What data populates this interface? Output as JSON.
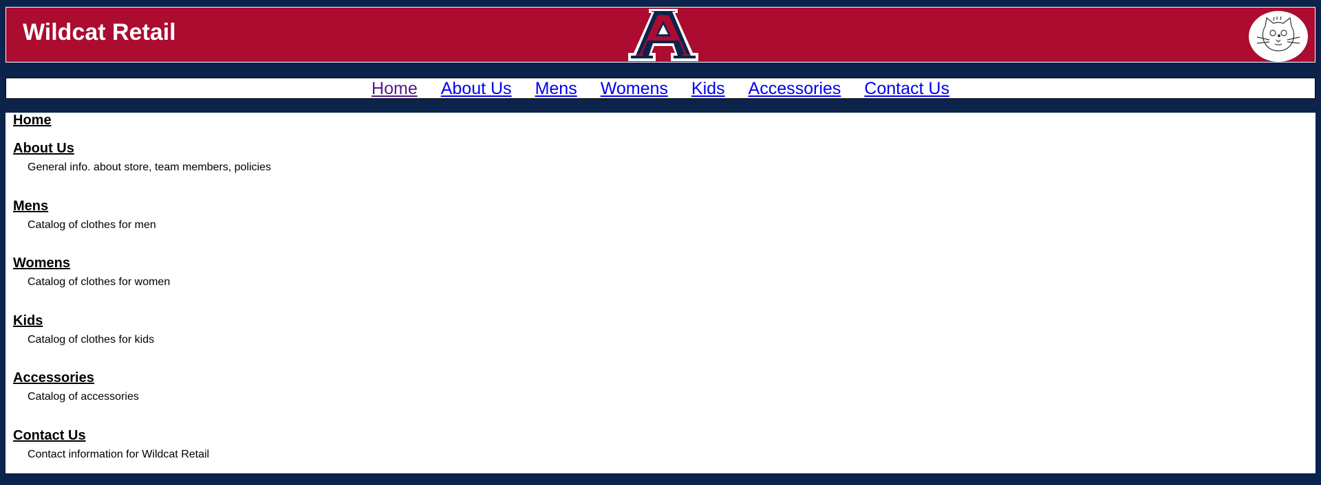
{
  "header": {
    "title": "Wildcat Retail",
    "colors": {
      "page_background": "#0c234b",
      "header_background": "#ab0c2f",
      "link": "#0000ee",
      "visited_link": "#551a8b"
    },
    "logos": [
      "block-a-logo",
      "wildcat-mascot-logo"
    ]
  },
  "nav": {
    "links": [
      "Home",
      "About Us",
      "Mens",
      "Womens",
      "Kids",
      "Accessories",
      "Contact Us"
    ]
  },
  "content": {
    "home_heading": "Home",
    "sections": [
      {
        "heading": "About Us",
        "description": "General info. about store, team members, policies"
      },
      {
        "heading": "Mens",
        "description": "Catalog of clothes for men"
      },
      {
        "heading": "Womens",
        "description": "Catalog of clothes for women"
      },
      {
        "heading": "Kids",
        "description": "Catalog of clothes for kids"
      },
      {
        "heading": "Accessories",
        "description": "Catalog of accessories"
      },
      {
        "heading": "Contact Us",
        "description": "Contact information for Wildcat Retail"
      }
    ]
  }
}
